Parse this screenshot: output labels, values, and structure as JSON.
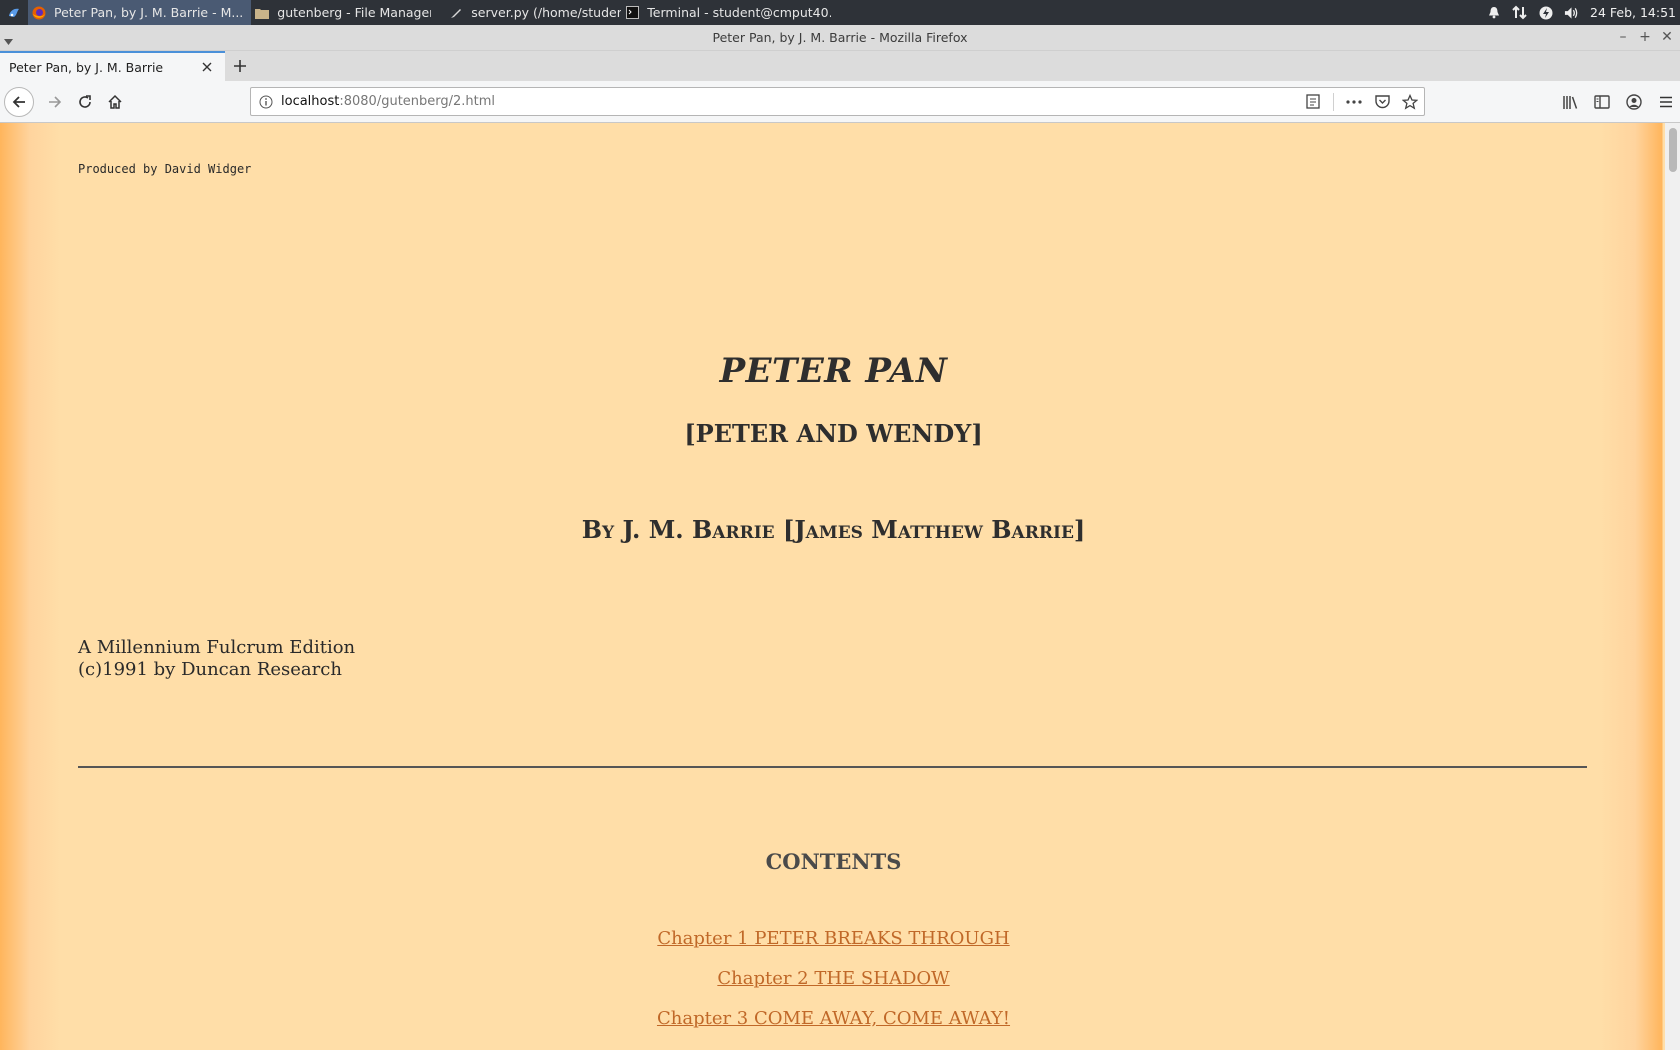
{
  "taskbar": {
    "tasks": [
      {
        "label": "Peter Pan, by J. M. Barrie - M...",
        "icon": "firefox-icon"
      },
      {
        "label": "gutenberg - File Manager",
        "icon": "folder-icon"
      },
      {
        "label": "server.py (/home/student/C...",
        "icon": "pen-icon"
      },
      {
        "label": "Terminal - student@cmput40...",
        "icon": "terminal-icon"
      }
    ],
    "tray_icons": [
      "bell-icon",
      "network-icon",
      "power-icon",
      "volume-icon"
    ],
    "clock": "24 Feb, 14:51"
  },
  "window": {
    "title": "Peter Pan, by J. M. Barrie - Mozilla Firefox"
  },
  "browser": {
    "tab_title": "Peter Pan, by J. M. Barrie",
    "url_host": "localhost",
    "url_path": ":8080/gutenberg/2.html"
  },
  "page": {
    "produced_by": "Produced by David Widger",
    "title": "PETER PAN",
    "subtitle": "[PETER AND WENDY]",
    "author": "By J. M. Barrie [James Matthew Barrie]",
    "edition_line1": "A Millennium Fulcrum Edition",
    "edition_line2": "(c)1991 by Duncan Research",
    "contents_heading": "CONTENTS",
    "toc": [
      "Chapter 1 PETER BREAKS THROUGH",
      "Chapter 2 THE SHADOW",
      "Chapter 3 COME AWAY, COME AWAY!"
    ]
  },
  "colors": {
    "page_bg": "#ffdea8",
    "link": "#c06828",
    "taskbar_bg": "#2e3238"
  }
}
